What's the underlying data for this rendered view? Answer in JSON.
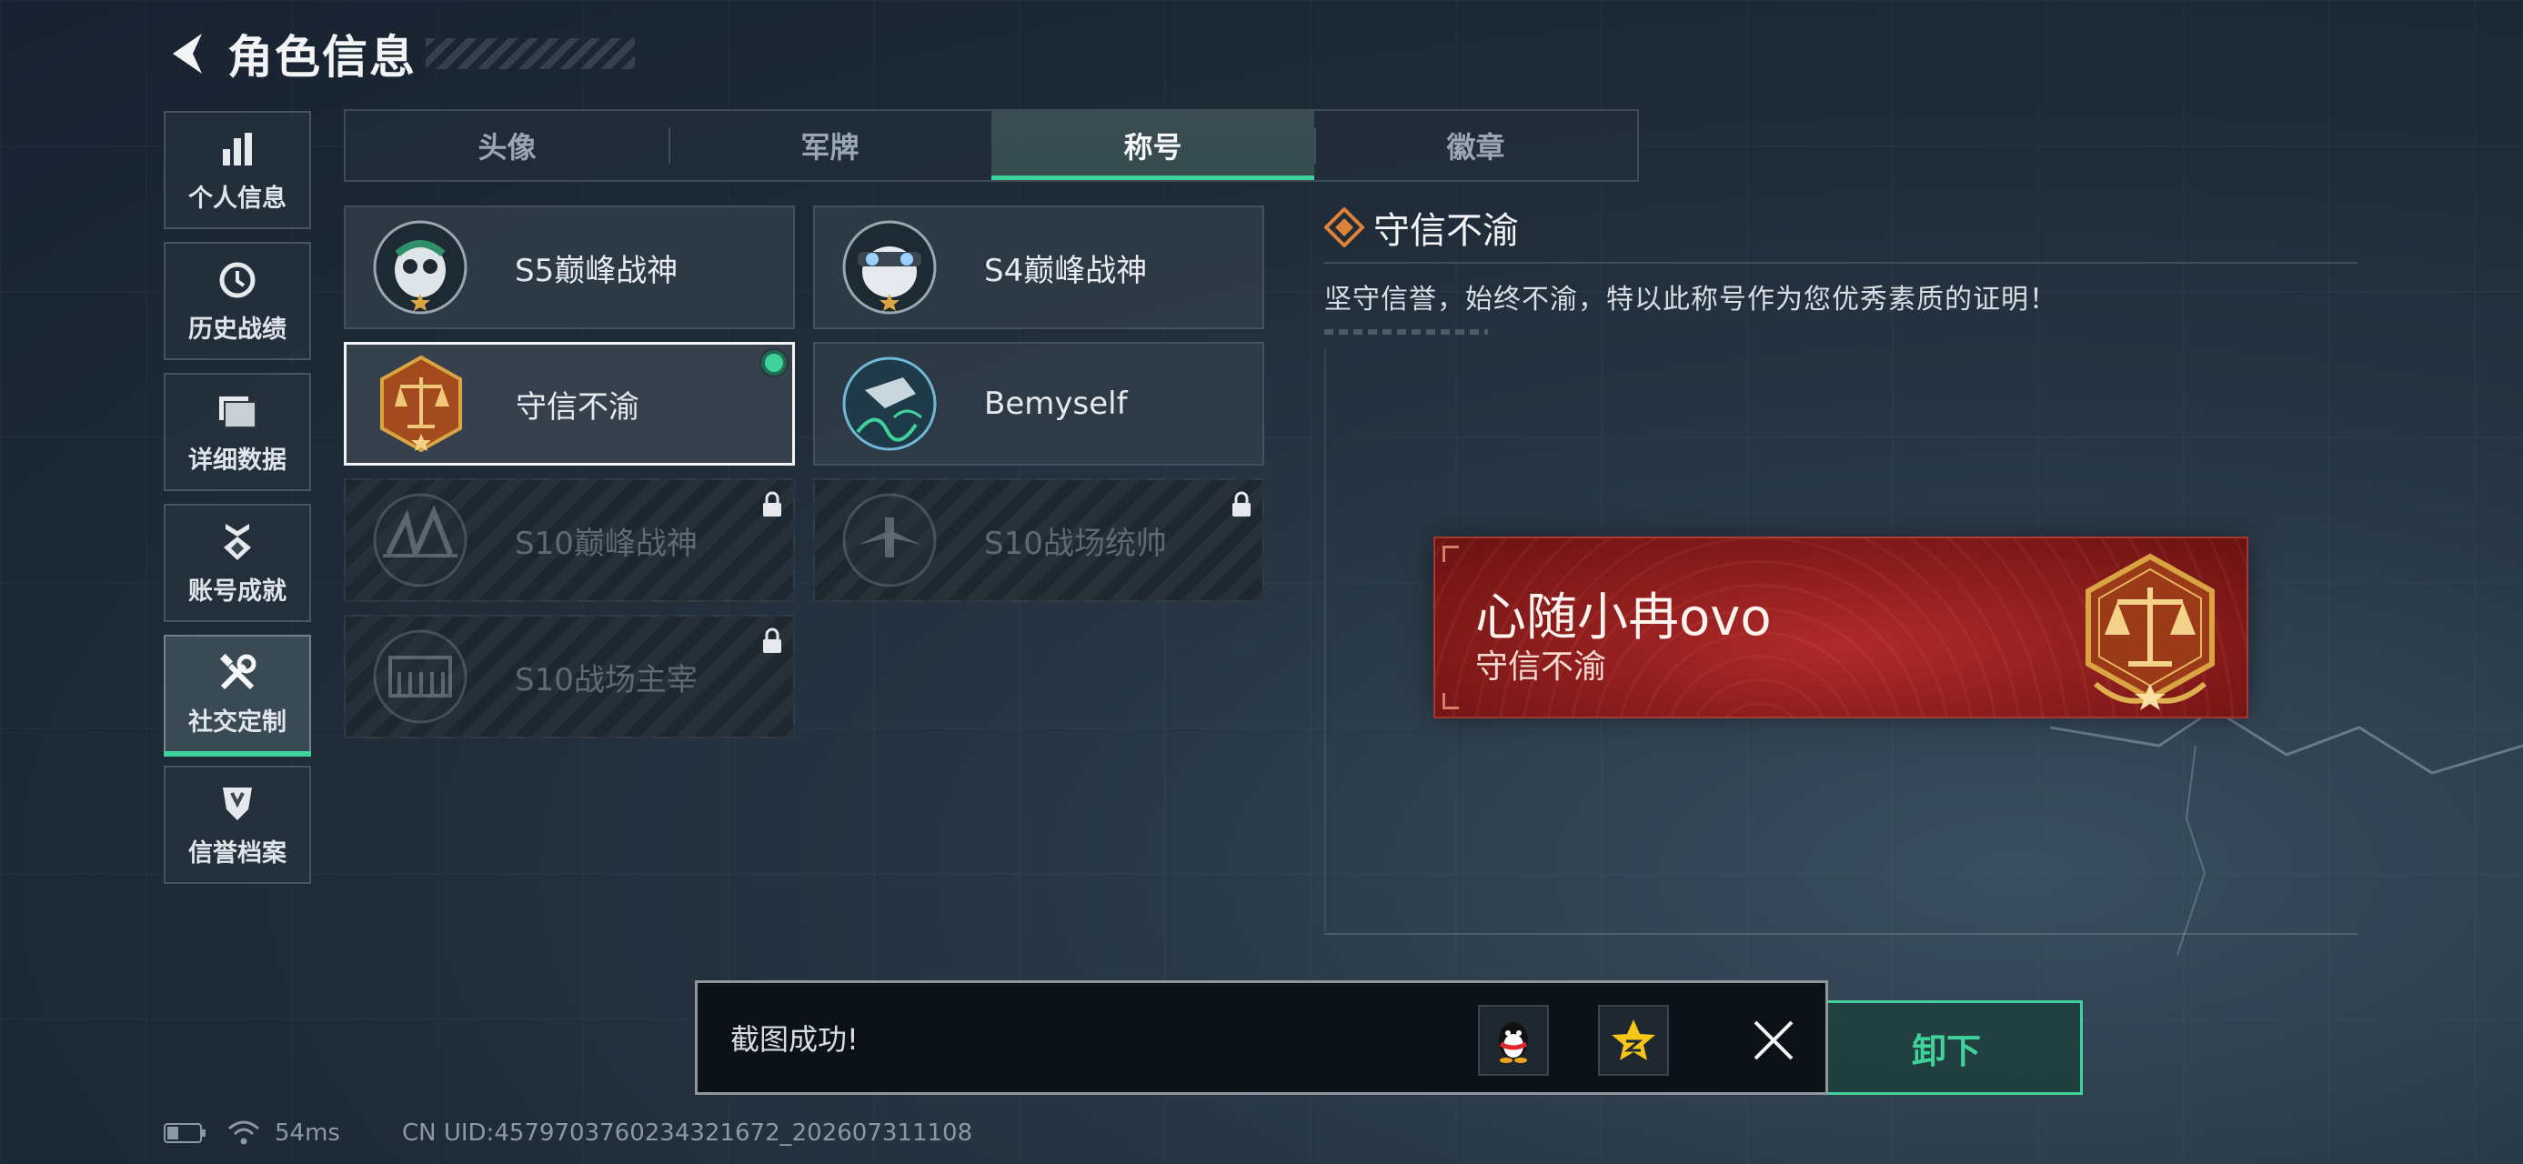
{
  "header": {
    "title": "角色信息"
  },
  "sidebar": {
    "items": [
      {
        "label": "个人信息",
        "icon": "bar-chart-icon"
      },
      {
        "label": "历史战绩",
        "icon": "clock-icon"
      },
      {
        "label": "详细数据",
        "icon": "folder-icon"
      },
      {
        "label": "账号成就",
        "icon": "badge-icon"
      },
      {
        "label": "社交定制",
        "icon": "tools-icon",
        "active": true
      },
      {
        "label": "信誉档案",
        "icon": "shield-icon"
      }
    ]
  },
  "tabs": [
    {
      "label": "头像"
    },
    {
      "label": "军牌"
    },
    {
      "label": "称号",
      "active": true
    },
    {
      "label": "徽章"
    }
  ],
  "titles": [
    {
      "label": "S5巅峰战神",
      "emblem": "skull-emblem-icon",
      "locked": false
    },
    {
      "label": "S4巅峰战神",
      "emblem": "skull-goggles-emblem-icon",
      "locked": false
    },
    {
      "label": "守信不渝",
      "emblem": "scales-emblem-icon",
      "locked": false,
      "selected": true,
      "equipped": true
    },
    {
      "label": "Bemyself",
      "emblem": "signature-emblem-icon",
      "locked": false
    },
    {
      "label": "S10巅峰战神",
      "emblem": "bridge-emblem-icon",
      "locked": true
    },
    {
      "label": "S10战场统帅",
      "emblem": "aircraft-emblem-icon",
      "locked": true
    },
    {
      "label": "S10战场主宰",
      "emblem": "colosseum-emblem-icon",
      "locked": true
    }
  ],
  "detail": {
    "title": "守信不渝",
    "description": "坚守信誉，始终不渝，特以此称号作为您优秀素质的证明！"
  },
  "preview": {
    "player_name": "心随小冉ovo",
    "title": "守信不渝"
  },
  "unequip_button": {
    "label": "卸下"
  },
  "toast": {
    "message": "截图成功!",
    "share_targets": [
      "qq-penguin-icon",
      "qzone-star-icon"
    ]
  },
  "status": {
    "ping": "54ms",
    "uid": "CN UID:4579703760234321672_202607311108"
  },
  "colors": {
    "accent": "#3fd29a",
    "banner_red": "#8a1c1c",
    "gold": "#d9a441"
  }
}
